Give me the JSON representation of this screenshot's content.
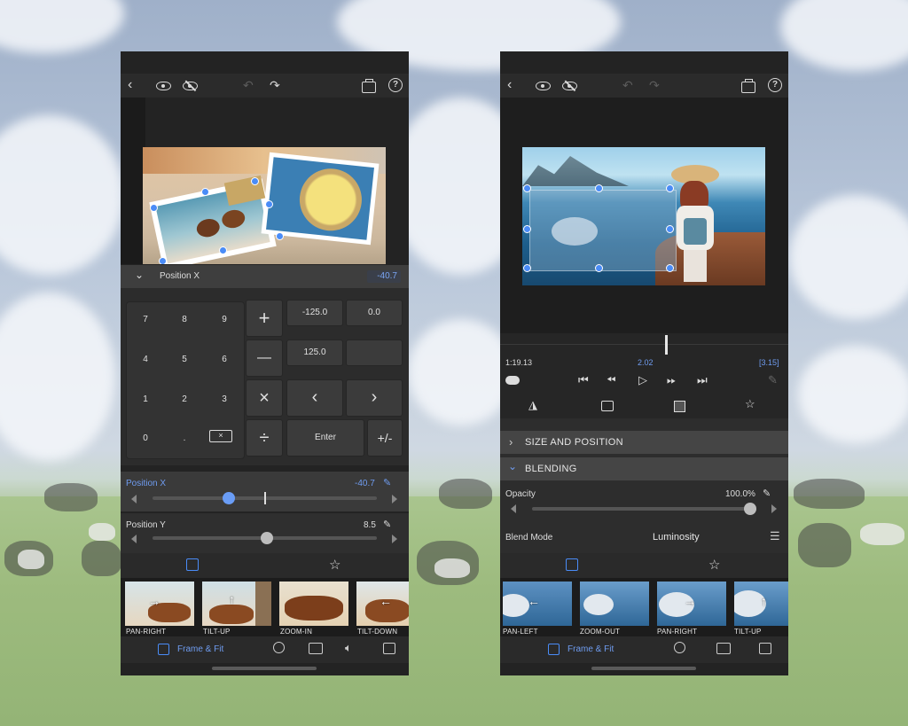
{
  "left": {
    "property_name": "Position X",
    "property_value": "-40.7",
    "keypad": {
      "digits": [
        "7",
        "8",
        "9",
        "4",
        "5",
        "6",
        "1",
        "2",
        "3",
        "0",
        "."
      ],
      "plus": "+",
      "minus": "—",
      "times": "×",
      "divide": "÷",
      "left": "‹",
      "right": "›",
      "enter": "Enter",
      "plusminus": "+/-",
      "presets": [
        "-125.0",
        "0.0",
        "125.0",
        ""
      ]
    },
    "position_x": {
      "label": "Position X",
      "value": "-40.7",
      "level": 0.33
    },
    "position_y": {
      "label": "Position Y",
      "value": "8.5",
      "level": 0.51
    },
    "presets": [
      {
        "label": "PAN-RIGHT",
        "arrow": "→"
      },
      {
        "label": "TILT-UP",
        "arrow": "↑"
      },
      {
        "label": "ZOOM-IN",
        "arrow": ""
      },
      {
        "label": "TILT-DOWN",
        "arrow": "←"
      }
    ],
    "bottom_active": "Frame & Fit"
  },
  "right": {
    "time_left": "1:19.13",
    "time_mid": "2.02",
    "time_right": "[3.15]",
    "sections": [
      {
        "label": "SIZE AND POSITION",
        "chevron": "›"
      },
      {
        "label": "BLENDING",
        "chevron": "⌄"
      }
    ],
    "opacity": {
      "label": "Opacity",
      "value": "100.0%",
      "level": 1.0
    },
    "blend_mode": {
      "label": "Blend Mode",
      "value": "Luminosity"
    },
    "presets": [
      {
        "label": "PAN-LEFT",
        "arrow": "←"
      },
      {
        "label": "ZOOM-OUT",
        "arrow": ""
      },
      {
        "label": "PAN-RIGHT",
        "arrow": "→"
      },
      {
        "label": "TILT-UP",
        "arrow": "↑"
      }
    ],
    "bottom_active": "Frame & Fit"
  },
  "colors": {
    "accent": "#4a8cf7",
    "panel": "#232323",
    "keypad": "#333333"
  }
}
